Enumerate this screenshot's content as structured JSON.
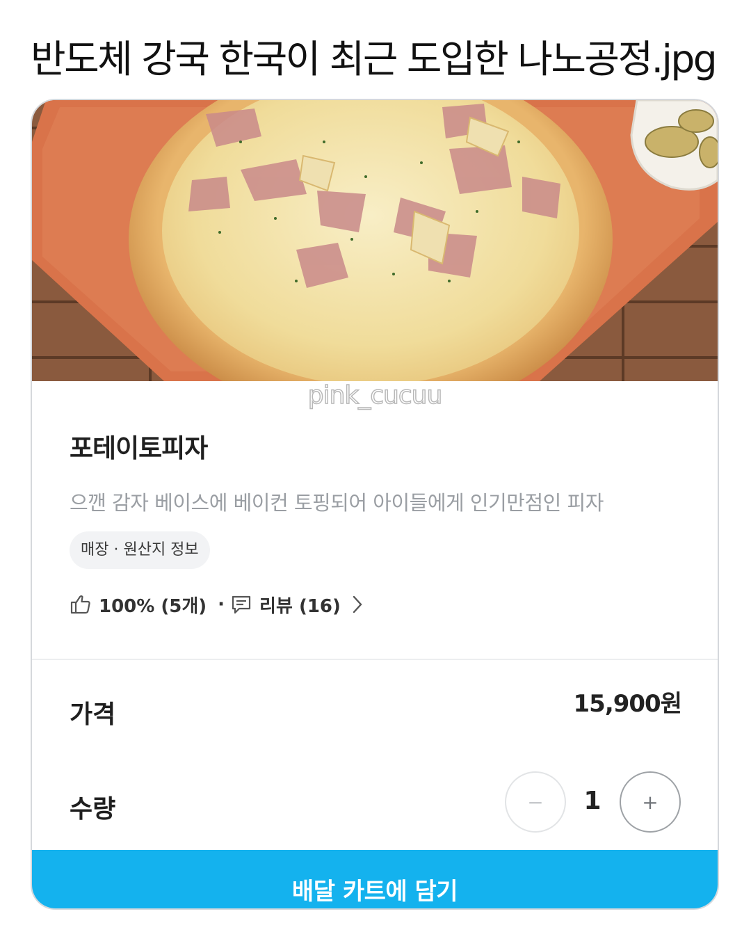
{
  "post": {
    "title": "반도체 강국 한국이 최근 도입한 나노공정.jpg"
  },
  "image": {
    "watermark": "pink_cucuu"
  },
  "product": {
    "name": "포테이토피자",
    "description": "으깬 감자 베이스에 베이컨 토핑되어 아이들에게 인기만점인 피자",
    "origin_chip": "매장 · 원산지 정보",
    "like_percent": "100% (5개)",
    "separator": "·",
    "review_label": "리뷰 (16)"
  },
  "price": {
    "label": "가격",
    "value": "15,900원"
  },
  "quantity": {
    "label": "수량",
    "value": "1",
    "minus": "−",
    "plus": "+"
  },
  "cart_button": {
    "label": "배달 카트에 담기"
  },
  "colors": {
    "accent": "#14b2ee",
    "muted_text": "#9a9ea3"
  },
  "icons": [
    "thumbs-up-icon",
    "review-icon",
    "chevron-right-icon"
  ]
}
